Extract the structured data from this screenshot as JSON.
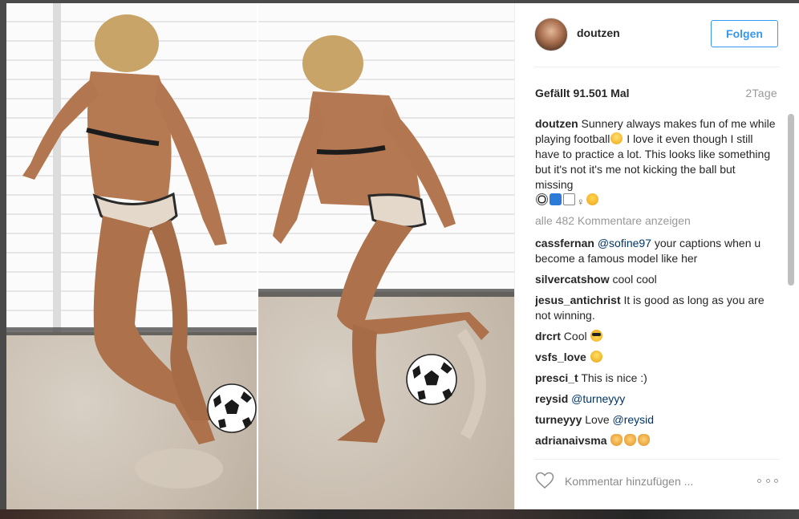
{
  "post": {
    "username": "doutzen",
    "follow_label": "Folgen",
    "likes": "Gefällt 91.501 Mal",
    "time": "2Tage",
    "caption": {
      "user": "doutzen",
      "text_part1": "Sunnery always makes fun of me while playing football",
      "text_part2": " I love it even though I still have to practice a lot. This looks like something but it's not it's me not kicking the ball but missing"
    },
    "view_all": "alle 482 Kommentare anzeigen",
    "comments": [
      {
        "user": "cassfernan",
        "mention": "@sofine97",
        "text": " your captions when u become a famous model like her"
      },
      {
        "user": "silvercatshow",
        "text": "cool cool"
      },
      {
        "user": "jesus_antichrist",
        "text": "It is good as long as you are not winning."
      },
      {
        "user": "drcrt",
        "text": "Cool"
      },
      {
        "user": "vsfs_love",
        "text": ""
      },
      {
        "user": "presci_t",
        "text": "This is nice :)"
      },
      {
        "user": "reysid",
        "mention": "@turneyyy",
        "text": ""
      },
      {
        "user": "turneyyy",
        "text": "Love ",
        "mention": "@reysid"
      },
      {
        "user": "adrianaivsma",
        "text": ""
      }
    ],
    "comment_placeholder": "Kommentar hinzufügen ..."
  },
  "icons": [
    "heart-icon",
    "more-options-icon",
    "soccer-ball-icon"
  ],
  "colors": {
    "accent": "#3897f0",
    "text": "#262626",
    "muted": "#999999",
    "mention": "#003569"
  }
}
